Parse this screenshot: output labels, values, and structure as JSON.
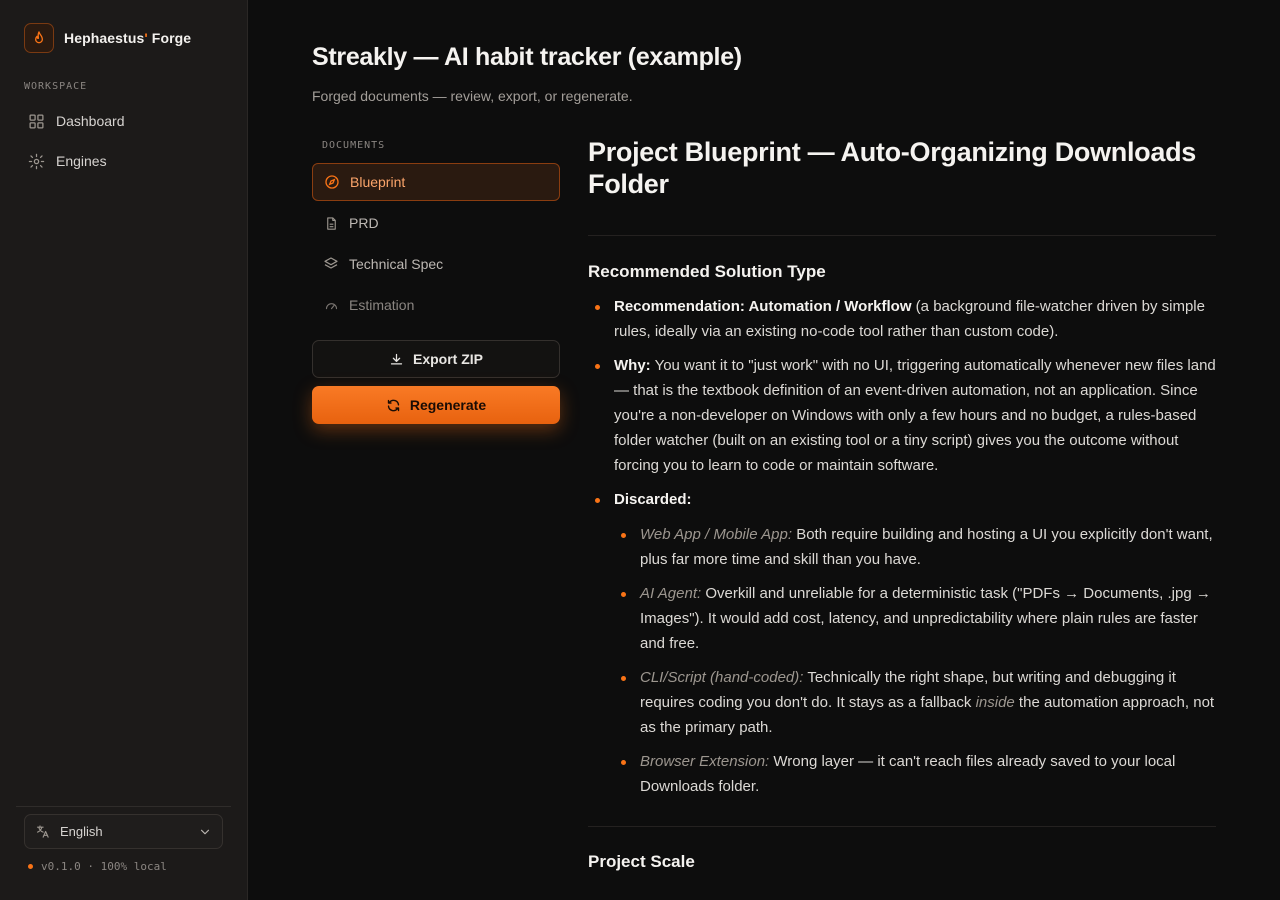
{
  "app": {
    "brand_prefix": "Hephaestus",
    "brand_apostrophe": "'",
    "brand_suffix": " Forge"
  },
  "sidebar": {
    "section_label": "WORKSPACE",
    "items": [
      {
        "label": "Dashboard",
        "icon": "grid-icon"
      },
      {
        "label": "Engines",
        "icon": "gear-icon"
      }
    ],
    "language": "English",
    "version": "v0.1.0 · 100% local"
  },
  "header": {
    "title": "Streakly — AI habit tracker (example)",
    "subtitle": "Forged documents — review, export, or regenerate."
  },
  "documents": {
    "label": "DOCUMENTS",
    "items": [
      {
        "label": "Blueprint",
        "icon": "compass-icon",
        "active": true
      },
      {
        "label": "PRD",
        "icon": "file-icon"
      },
      {
        "label": "Technical Spec",
        "icon": "layers-icon"
      },
      {
        "label": "Estimation",
        "icon": "gauge-icon"
      }
    ],
    "export_label": "Export ZIP",
    "regenerate_label": "Regenerate"
  },
  "content": {
    "title": "Project Blueprint — Auto-Organizing Downloads Folder",
    "section1_heading": "Recommended Solution Type",
    "rec_label": "Recommendation: Automation / Workflow",
    "rec_text": " (a background file-watcher driven by simple rules, ideally via an existing no-code tool rather than custom code).",
    "why_label": "Why:",
    "why_text": " You want it to \"just work\" with no UI, triggering automatically whenever new files land — that is the textbook definition of an event-driven automation, not an application. Since you're a non-developer on Windows with only a few hours and no budget, a rules-based folder watcher (built on an existing tool or a tiny script) gives you the outcome without forcing you to learn to code or maintain software.",
    "discarded_label": "Discarded:",
    "discarded": [
      {
        "label": "Web App / Mobile App:",
        "text": " Both require building and hosting a UI you explicitly don't want, plus far more time and skill than you have."
      },
      {
        "label": "AI Agent:",
        "text": " Overkill and unreliable for a deterministic task (\"PDFs → Documents, .jpg → Images\"). It would add cost, latency, and unpredictability where plain rules are faster and free."
      },
      {
        "label": "CLI/Script (hand-coded):",
        "text_before": " Technically the right shape, but writing and debugging it requires coding you don't do. It stays as a fallback ",
        "text_em": "inside",
        "text_after": " the automation approach, not as the primary path."
      },
      {
        "label": "Browser Extension:",
        "text": " Wrong layer — it can't reach files already saved to your local Downloads folder."
      }
    ],
    "section2_heading": "Project Scale"
  },
  "colors": {
    "accent": "#f97316",
    "background": "#0d0d0d",
    "sidebar": "#1c1a19"
  }
}
